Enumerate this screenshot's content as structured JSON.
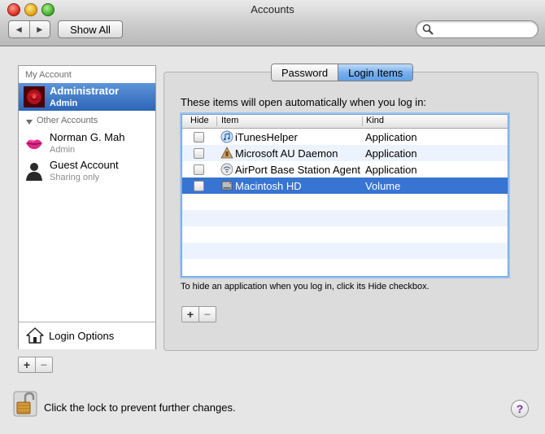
{
  "window": {
    "title": "Accounts"
  },
  "toolbar": {
    "back_glyph": "◀",
    "forward_glyph": "▶",
    "show_all_label": "Show All",
    "search": {
      "value": "",
      "icon": "search-icon"
    }
  },
  "sidebar": {
    "my_account_header": "My Account",
    "other_accounts_header": "Other Accounts",
    "accounts": [
      {
        "name": "Administrator",
        "role": "Admin",
        "icon": "red-rose-avatar",
        "selected": true
      },
      {
        "name": "Norman G. Mah",
        "role": "Admin",
        "icon": "lips-avatar",
        "selected": false
      },
      {
        "name": "Guest Account",
        "role": "Sharing only",
        "icon": "silhouette-avatar",
        "selected": false
      }
    ],
    "login_options_label": "Login Options",
    "add_glyph": "+",
    "remove_glyph": "−"
  },
  "tabs": [
    {
      "label": "Password",
      "active": false
    },
    {
      "label": "Login Items",
      "active": true
    }
  ],
  "login_items": {
    "intro": "These items will open automatically when you log in:",
    "columns": {
      "hide": "Hide",
      "item": "Item",
      "kind": "Kind"
    },
    "rows": [
      {
        "name": "iTunesHelper",
        "kind": "Application",
        "hide": false,
        "icon": "itunes-icon"
      },
      {
        "name": "Microsoft AU Daemon",
        "kind": "Application",
        "hide": false,
        "icon": "app-icon"
      },
      {
        "name": "AirPort Base Station Agent",
        "kind": "Application",
        "hide": false,
        "icon": "airport-icon"
      },
      {
        "name": "Macintosh HD",
        "kind": "Volume",
        "hide": false,
        "icon": "hard-drive-icon",
        "selected": true
      }
    ],
    "hint": "To hide an application when you log in, click its Hide checkbox.",
    "add_glyph": "+",
    "remove_glyph": "−"
  },
  "footer": {
    "lock_text": "Click the lock to prevent further changes.",
    "help_glyph": "?"
  },
  "colors": {
    "selection": "#3874d1",
    "alt_row": "#edf3fe",
    "active_tab": "#79b1ee"
  }
}
